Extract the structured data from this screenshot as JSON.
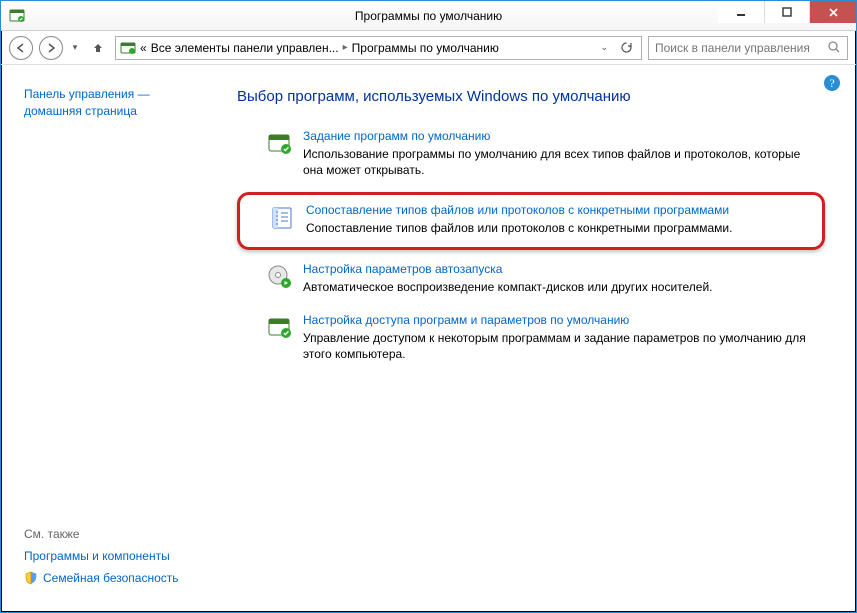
{
  "window": {
    "title": "Программы по умолчанию"
  },
  "breadcrumb": {
    "prefix": "«",
    "item1": "Все элементы панели управлен...",
    "item2": "Программы по умолчанию"
  },
  "search": {
    "placeholder": "Поиск в панели управления"
  },
  "sidebar": {
    "home1": "Панель управления —",
    "home2": "домашняя страница",
    "see_also": "См. также",
    "programs_components": "Программы и компоненты",
    "family_safety": "Семейная безопасность"
  },
  "main": {
    "heading": "Выбор программ, используемых Windows по умолчанию",
    "options": [
      {
        "title": "Задание программ по умолчанию",
        "desc": "Использование программы по умолчанию для всех типов файлов и протоколов, которые она может открывать."
      },
      {
        "title": "Сопоставление типов файлов или протоколов с конкретными программами",
        "desc": "Сопоставление типов файлов или протоколов с конкретными программами."
      },
      {
        "title": "Настройка параметров автозапуска",
        "desc": "Автоматическое воспроизведение компакт-дисков или других носителей."
      },
      {
        "title": "Настройка доступа программ и параметров по умолчанию",
        "desc": "Управление доступом к некоторым программам и задание параметров по умолчанию для этого компьютера."
      }
    ]
  }
}
